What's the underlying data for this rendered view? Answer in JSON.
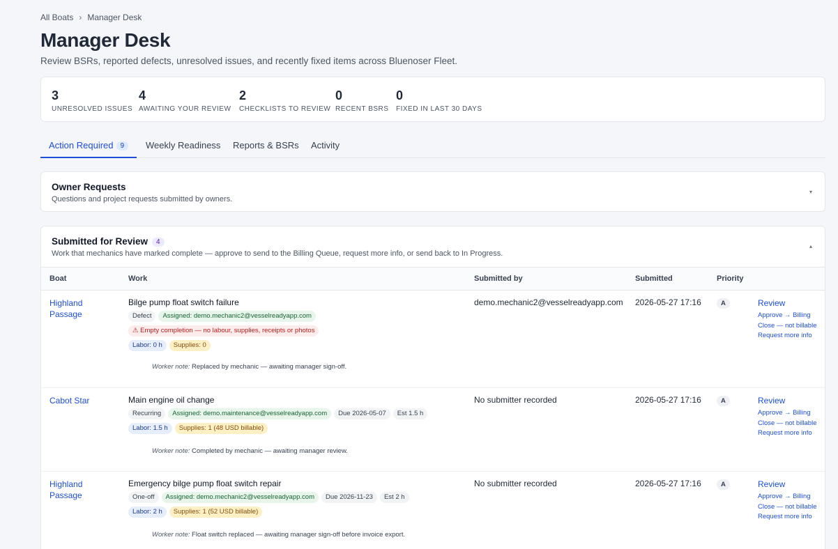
{
  "breadcrumb": {
    "root": "All Boats",
    "separator": "›",
    "current": "Manager Desk"
  },
  "page": {
    "title": "Manager Desk",
    "subtitle": "Review BSRs, reported defects, unresolved issues, and recently fixed items across Bluenoser Fleet."
  },
  "stats": [
    {
      "value": "3",
      "label": "UNRESOLVED ISSUES"
    },
    {
      "value": "4",
      "label": "AWAITING YOUR REVIEW"
    },
    {
      "value": "2",
      "label": "CHECKLISTS TO REVIEW"
    },
    {
      "value": "0",
      "label": "RECENT BSRS"
    },
    {
      "value": "0",
      "label": "FIXED IN LAST 30 DAYS"
    }
  ],
  "tabs": [
    {
      "label": "Action Required",
      "count": "9"
    },
    {
      "label": "Weekly Readiness"
    },
    {
      "label": "Reports & BSRs"
    },
    {
      "label": "Activity"
    }
  ],
  "owner_requests": {
    "title": "Owner Requests",
    "description": "Questions and project requests submitted by owners.",
    "chevron": "▾"
  },
  "review": {
    "title": "Submitted for Review",
    "count": "4",
    "description": "Work that mechanics have marked complete — approve to send to the Billing Queue, request more info, or send back to In Progress.",
    "chevron": "▴",
    "columns": [
      "Boat",
      "Work",
      "Submitted by",
      "Submitted",
      "Priority"
    ],
    "action_labels": {
      "review": "Review",
      "approve": "Approve → Billing",
      "close": "Close — not billable",
      "more_info": "Request more info"
    },
    "rows": [
      {
        "boat": "Highland Passage",
        "work": "Bilge pump float switch failure",
        "chips": [
          "Defect",
          "Assigned: demo.mechanic2@vesselreadyapp.com"
        ],
        "warning": "⚠ Empty completion — no labour, supplies, receipts or photos",
        "labor": "Labor: 0 h",
        "supplies": "Supplies: 0",
        "note_label": "Worker note:",
        "note": "Replaced by mechanic — awaiting manager sign-off.",
        "submitted_by": "demo.mechanic2@vesselreadyapp.com",
        "submitted": "2026-05-27 17:16",
        "priority": "A"
      },
      {
        "boat": "Cabot Star",
        "work": "Main engine oil change",
        "chips": [
          "Recurring",
          "Assigned: demo.maintenance@vesselreadyapp.com",
          "Due 2026-05-07",
          "Est 1.5 h"
        ],
        "labor": "Labor: 1.5 h",
        "supplies": "Supplies: 1 (48 USD billable)",
        "note_label": "Worker note:",
        "note": "Completed by mechanic — awaiting manager review.",
        "submitted_by": "No submitter recorded",
        "submitted": "2026-05-27 17:16",
        "priority": "A"
      },
      {
        "boat": "Highland Passage",
        "work": "Emergency bilge pump float switch repair",
        "chips": [
          "One-off",
          "Assigned: demo.mechanic2@vesselreadyapp.com",
          "Due 2026-11-23",
          "Est 2 h"
        ],
        "labor": "Labor: 2 h",
        "supplies": "Supplies: 1 (52 USD billable)",
        "note_label": "Worker note:",
        "note": "Float switch replaced — awaiting manager sign-off before invoice export.",
        "submitted_by": "No submitter recorded",
        "submitted": "2026-05-27 17:16",
        "priority": "A"
      }
    ]
  }
}
